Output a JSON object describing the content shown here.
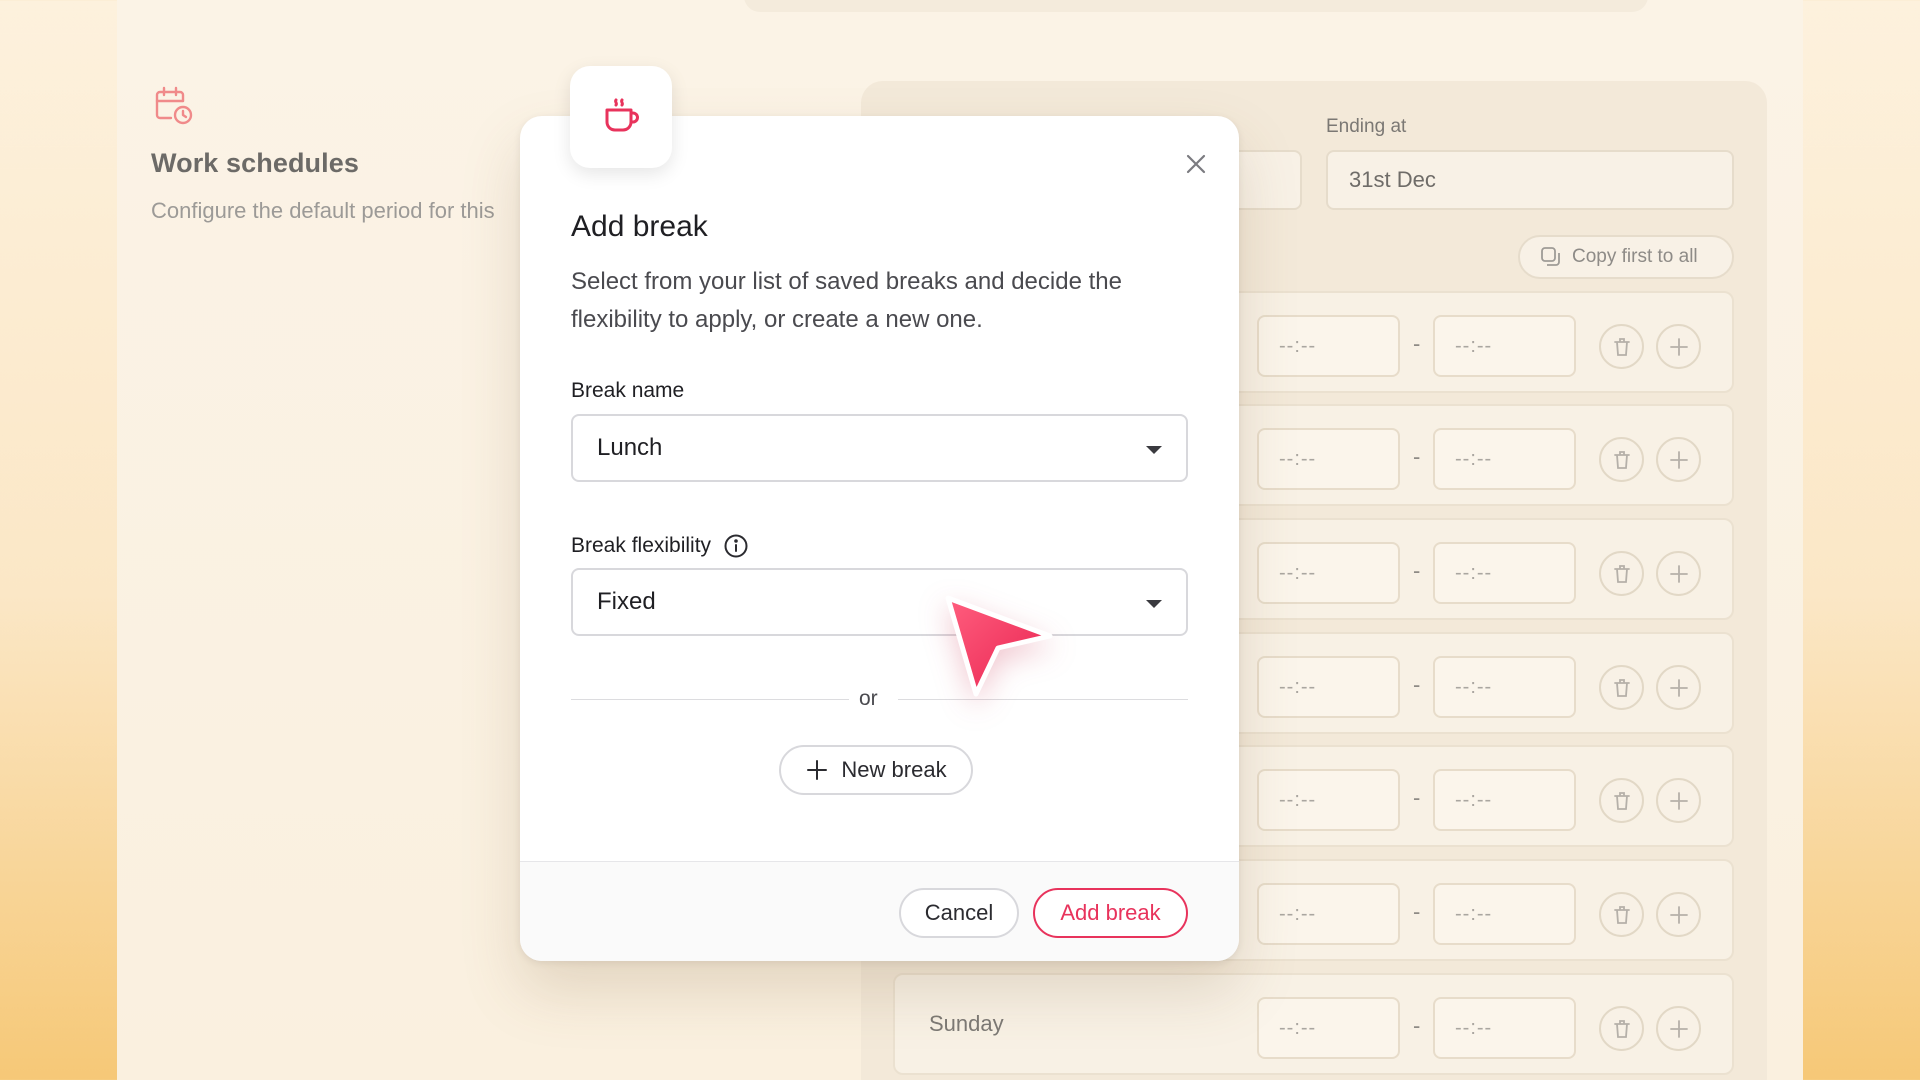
{
  "background": {
    "section": {
      "title": "Work schedules",
      "description": "Configure the default period for this"
    },
    "ending_label": "Ending at",
    "ending_value": "31st Dec",
    "copy_button": "Copy first to all",
    "time_placeholder": "--:--",
    "dash": "-",
    "visible_day": "Sunday"
  },
  "modal": {
    "title": "Add break",
    "description": "Select from your list of saved breaks and decide the flexibility to apply, or create a new one.",
    "break_name_label": "Break name",
    "break_name_value": "Lunch",
    "flexibility_label": "Break flexibility",
    "flexibility_value": "Fixed",
    "divider_text": "or",
    "new_break_label": "New break",
    "cancel_label": "Cancel",
    "add_label": "Add break"
  },
  "colors": {
    "accent": "#e8335c",
    "icon_pink": "#f08a8a"
  },
  "icons": {
    "section": "calendar-clock-icon",
    "badge": "coffee-cup-icon",
    "close": "close-icon",
    "info": "info-icon",
    "copy": "copy-icon",
    "trash": "trash-icon",
    "plus": "plus-icon",
    "cursor": "cursor-arrow"
  }
}
